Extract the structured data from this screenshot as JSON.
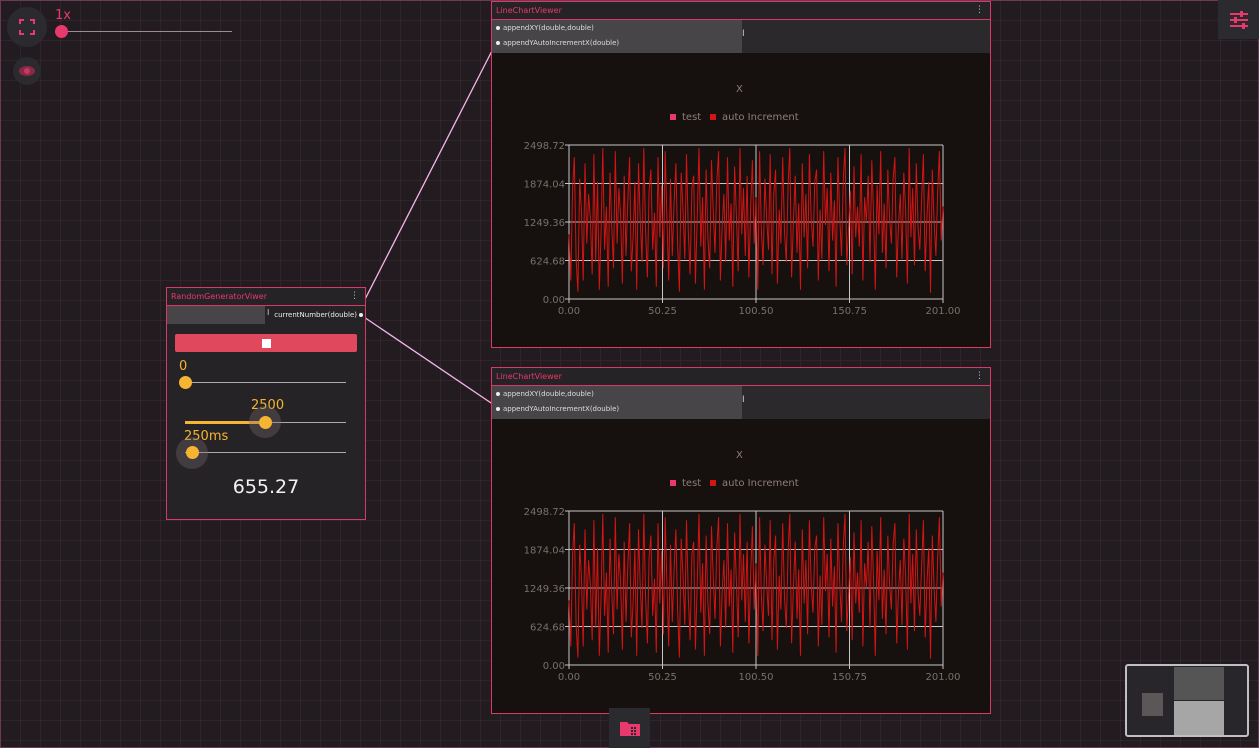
{
  "toolbar": {
    "speed_label": "1x",
    "fullscreen_icon": "fullscreen-icon",
    "visibility_icon": "eye-icon",
    "settings_icon": "tune-icon",
    "bottom_icon": "dashboard-icon"
  },
  "colors": {
    "accent": "#e8386c",
    "node_border": "#d83a65",
    "slider": "#f5b431",
    "series": "#d31414",
    "connection": "#f7b6e8"
  },
  "random_generator": {
    "title": "RandomGeneratorViwer",
    "menu": "⋮",
    "output_port": "currentNumber(double)",
    "cursor": "I",
    "min_slider": {
      "label": "0",
      "fraction": 0.0
    },
    "max_slider": {
      "label": "2500",
      "fraction": 0.5
    },
    "interval_slider": {
      "label": "250ms",
      "fraction": 0.0
    },
    "current_value": "655.27"
  },
  "chart_viewers": [
    {
      "title": "LineChartViewer",
      "menu": "⋮",
      "ports": [
        "appendXY(double,double)",
        "appendYAutoIncrementX(double)"
      ],
      "cursor": "I",
      "legend": [
        "test",
        "auto Increment"
      ],
      "x_title": "X",
      "x_ticks": [
        "0.00",
        "50.25",
        "100.50",
        "150.75",
        "201.00"
      ],
      "y_ticks": [
        "0.00",
        "624.68",
        "1249.36",
        "1874.04",
        "2498.72"
      ]
    },
    {
      "title": "LineChartViewer",
      "menu": "⋮",
      "ports": [
        "appendXY(double,double)",
        "appendYAutoIncrementX(double)"
      ],
      "cursor": "I",
      "legend": [
        "test",
        "auto Increment"
      ],
      "x_title": "X",
      "x_ticks": [
        "0.00",
        "50.25",
        "100.50",
        "150.75",
        "201.00"
      ],
      "y_ticks": [
        "0.00",
        "624.68",
        "1249.36",
        "1874.04",
        "2498.72"
      ]
    }
  ],
  "chart_data": [
    {
      "type": "line",
      "xlabel": "X",
      "xlim": [
        0,
        201
      ],
      "ylim": [
        0,
        2498.72
      ],
      "grid": true,
      "legend_position": "top",
      "series": [
        {
          "name": "test",
          "values": [],
          "color": "#e8386c"
        },
        {
          "name": "auto Increment",
          "color": "#d31414",
          "values": [
            1050,
            300,
            1800,
            2300,
            650,
            120,
            1950,
            1400,
            300,
            2200,
            900,
            1700,
            1300,
            400,
            2350,
            600,
            1900,
            150,
            1100,
            2450,
            800,
            1500,
            200,
            2050,
            1200,
            500,
            2400,
            900,
            1800,
            1350,
            250,
            2000,
            700,
            1600,
            2300,
            450,
            1000,
            1900,
            150,
            2200,
            1300,
            600,
            2450,
            1100,
            350,
            1750,
            2100,
            800,
            1400,
            200,
            2300,
            1000,
            1850,
            500,
            2400,
            1250,
            300,
            1950,
            700,
            1550,
            2200,
            900,
            120,
            2050,
            1450,
            650,
            2350,
            1100,
            400,
            1800,
            2000,
            250,
            1300,
            2450,
            850,
            1650,
            150,
            2100,
            1000,
            500,
            2250,
            1400,
            750,
            1900,
            2400,
            300,
            1200,
            1700,
            600,
            2300,
            950,
            1550,
            200,
            2150,
            1350,
            450,
            2450,
            1050,
            1800,
            700,
            2000,
            350,
            1500,
            2250,
            900,
            1650,
            150,
            2400,
            1150,
            550,
            1950,
            1300,
            800,
            2350,
            400,
            1700,
            2100,
            250,
            1450,
            900,
            2300,
            1100,
            600,
            1850,
            2450,
            350,
            1250,
            2000,
            750,
            1550,
            150,
            2200,
            1000,
            1700,
            500,
            2350,
            1300,
            850,
            1900,
            2100,
            300,
            1450,
            650,
            2400,
            1200,
            1800,
            450,
            2050,
            950,
            1600,
            200,
            2300,
            1350,
            700,
            1950,
            2450,
            550,
            1150,
            1750,
            400,
            2150,
            1000,
            1500,
            850,
            2350,
            300,
            1650,
            1250,
            2000,
            600,
            2250,
            1400,
            150,
            1850,
            1050,
            2400,
            750,
            1550,
            500,
            2100,
            1300,
            900,
            1950,
            2300,
            350,
            1200,
            1700,
            650,
            2050,
            1450,
            250,
            2450,
            1000,
            1800,
            550,
            2200,
            1150,
            800,
            1600,
            2350,
            450,
            1350,
            1900,
            100,
            2100,
            1250,
            700,
            1750,
            2400,
            950,
            1500
          ]
        }
      ]
    },
    {
      "type": "line",
      "xlabel": "X",
      "xlim": [
        0,
        201
      ],
      "ylim": [
        0,
        2498.72
      ],
      "grid": true,
      "legend_position": "top",
      "series": [
        {
          "name": "test",
          "values": [],
          "color": "#e8386c"
        },
        {
          "name": "auto Increment",
          "color": "#d31414",
          "values": [
            1050,
            300,
            1800,
            2300,
            650,
            120,
            1950,
            1400,
            300,
            2200,
            900,
            1700,
            1300,
            400,
            2350,
            600,
            1900,
            150,
            1100,
            2450,
            800,
            1500,
            200,
            2050,
            1200,
            500,
            2400,
            900,
            1800,
            1350,
            250,
            2000,
            700,
            1600,
            2300,
            450,
            1000,
            1900,
            150,
            2200,
            1300,
            600,
            2450,
            1100,
            350,
            1750,
            2100,
            800,
            1400,
            200,
            2300,
            1000,
            1850,
            500,
            2400,
            1250,
            300,
            1950,
            700,
            1550,
            2200,
            900,
            120,
            2050,
            1450,
            650,
            2350,
            1100,
            400,
            1800,
            2000,
            250,
            1300,
            2450,
            850,
            1650,
            150,
            2100,
            1000,
            500,
            2250,
            1400,
            750,
            1900,
            2400,
            300,
            1200,
            1700,
            600,
            2300,
            950,
            1550,
            200,
            2150,
            1350,
            450,
            2450,
            1050,
            1800,
            700,
            2000,
            350,
            1500,
            2250,
            900,
            1650,
            150,
            2400,
            1150,
            550,
            1950,
            1300,
            800,
            2350,
            400,
            1700,
            2100,
            250,
            1450,
            900,
            2300,
            1100,
            600,
            1850,
            2450,
            350,
            1250,
            2000,
            750,
            1550,
            150,
            2200,
            1000,
            1700,
            500,
            2350,
            1300,
            850,
            1900,
            2100,
            300,
            1450,
            650,
            2400,
            1200,
            1800,
            450,
            2050,
            950,
            1600,
            200,
            2300,
            1350,
            700,
            1950,
            2450,
            550,
            1150,
            1750,
            400,
            2150,
            1000,
            1500,
            850,
            2350,
            300,
            1650,
            1250,
            2000,
            600,
            2250,
            1400,
            150,
            1850,
            1050,
            2400,
            750,
            1550,
            500,
            2100,
            1300,
            900,
            1950,
            2300,
            350,
            1200,
            1700,
            650,
            2050,
            1450,
            250,
            2450,
            1000,
            1800,
            550,
            2200,
            1150,
            800,
            1600,
            2350,
            450,
            1350,
            1900,
            100,
            2100,
            1250,
            700,
            1750,
            2400,
            950,
            1500
          ]
        }
      ]
    }
  ]
}
